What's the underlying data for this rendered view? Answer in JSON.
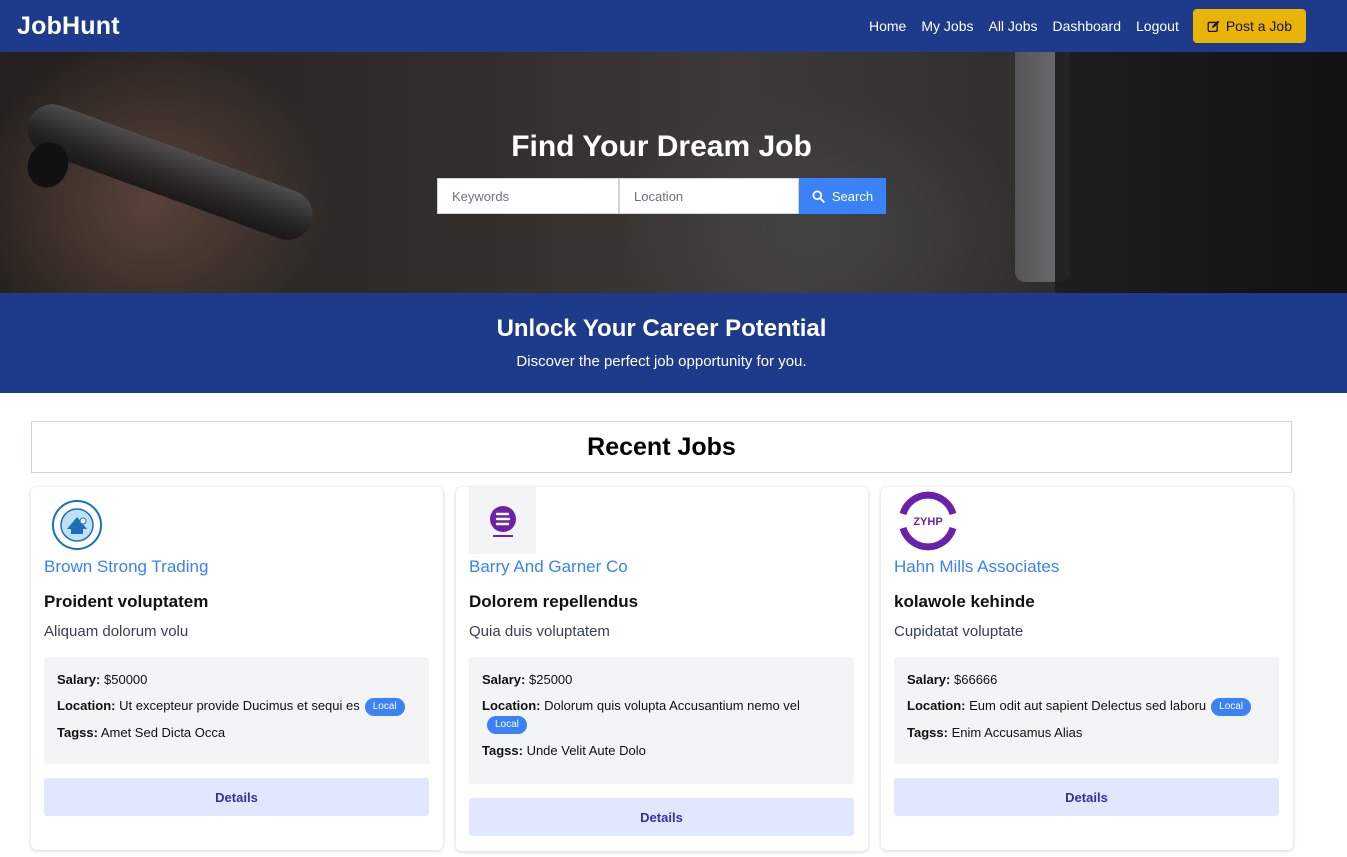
{
  "nav": {
    "brand": "JobHunt",
    "links": [
      "Home",
      "My Jobs",
      "All Jobs",
      "Dashboard",
      "Logout"
    ],
    "post_button": "Post a Job",
    "post_icon": "edit-icon"
  },
  "hero": {
    "title": "Find Your Dream Job",
    "keywords_placeholder": "Keywords",
    "location_placeholder": "Location",
    "search_button": "Search",
    "search_icon": "search-icon"
  },
  "banner": {
    "title": "Unlock Your Career Potential",
    "subtitle": "Discover the perfect job opportunity for you."
  },
  "recent": {
    "title": "Recent Jobs"
  },
  "labels": {
    "salary": "Salary:",
    "location": "Location:",
    "tags": "Tagss:",
    "details": "Details"
  },
  "jobs": [
    {
      "company": "Brown Strong Trading",
      "title": "Proident voluptatem",
      "description": "Aliquam dolorum volu",
      "salary": "$50000",
      "location": "Ut excepteur provide Ducimus et sequi es",
      "location_badge": "Local",
      "tags": "Amet Sed Dicta Occa"
    },
    {
      "company": "Barry And Garner Co",
      "title": "Dolorem repellendus",
      "description": "Quia duis voluptatem",
      "salary": "$25000",
      "location": "Dolorum quis volupta Accusantium nemo vel",
      "location_badge": "Local",
      "tags": "Unde Velit Aute Dolo"
    },
    {
      "company": "Hahn Mills Associates",
      "title": "kolawole kehinde",
      "description": "Cupidatat voluptate",
      "salary": "$66666",
      "location": "Eum odit aut sapient Delectus sed laboru",
      "location_badge": "Local",
      "tags": "Enim Accusamus Alias",
      "logo_text": "ZYHP"
    }
  ],
  "colors": {
    "nav_bg": "#1e3a8a",
    "accent": "#3b82f6",
    "post_button": "#eab308",
    "details_bg": "#e0e7ff"
  }
}
